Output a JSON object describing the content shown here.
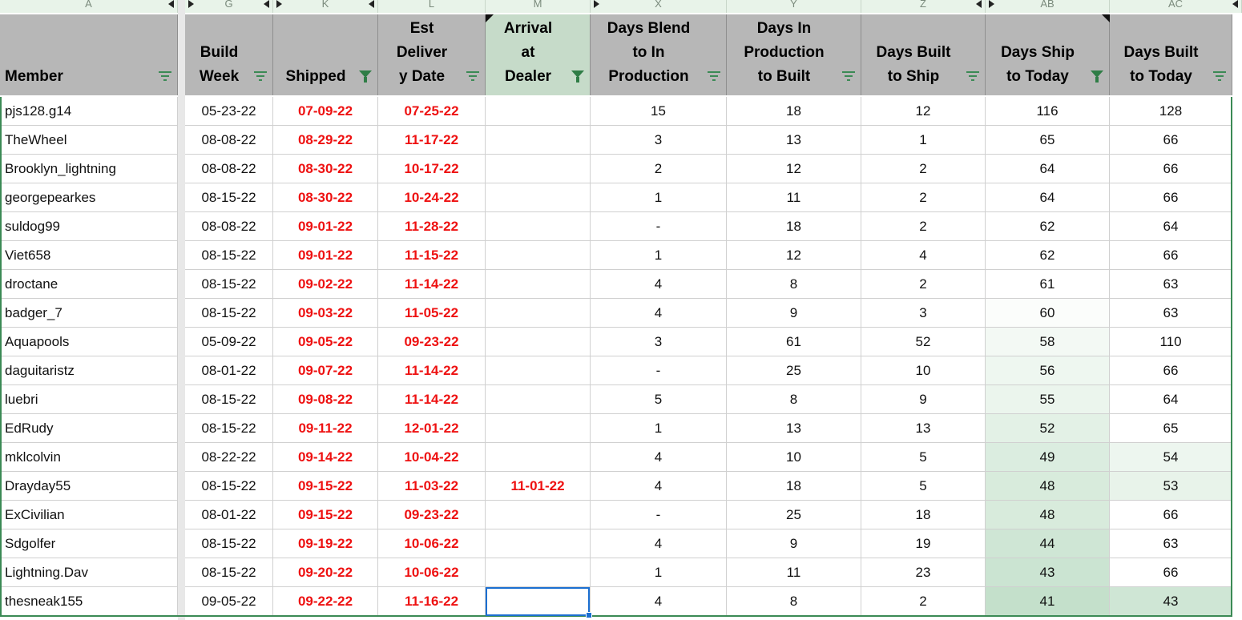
{
  "column_letters": [
    "A",
    "G",
    "K",
    "L",
    "M",
    "X",
    "Y",
    "Z",
    "AB",
    "AC"
  ],
  "headers": [
    {
      "label": "Member",
      "filter": "lines"
    },
    {
      "label": "Build\nWeek",
      "filter": "lines"
    },
    {
      "label": "Shipped",
      "filter": "funnel"
    },
    {
      "label": "Est\nDeliver\ny Date",
      "filter": "lines"
    },
    {
      "label": "Arrival\nat\nDealer",
      "filter": "funnel"
    },
    {
      "label": "Days Blend\nto In\nProduction",
      "filter": "lines"
    },
    {
      "label": "Days In\nProduction\nto Built",
      "filter": "lines"
    },
    {
      "label": "Days Built\nto Ship",
      "filter": "lines"
    },
    {
      "label": "Days Ship\nto Today",
      "filter": "funnel"
    },
    {
      "label": "Days Built\nto Today",
      "filter": "lines"
    }
  ],
  "rows": [
    [
      "pjs128.g14",
      "05-23-22",
      "07-09-22",
      "07-25-22",
      "",
      "15",
      "18",
      "12",
      "116",
      "128"
    ],
    [
      "TheWheel",
      "08-08-22",
      "08-29-22",
      "11-17-22",
      "",
      "3",
      "13",
      "1",
      "65",
      "66"
    ],
    [
      "Brooklyn_lightning",
      "08-08-22",
      "08-30-22",
      "10-17-22",
      "",
      "2",
      "12",
      "2",
      "64",
      "66"
    ],
    [
      "georgepearkes",
      "08-15-22",
      "08-30-22",
      "10-24-22",
      "",
      "1",
      "11",
      "2",
      "64",
      "66"
    ],
    [
      "suldog99",
      "08-08-22",
      "09-01-22",
      "11-28-22",
      "",
      "-",
      "18",
      "2",
      "62",
      "64"
    ],
    [
      "Viet658",
      "08-15-22",
      "09-01-22",
      "11-15-22",
      "",
      "1",
      "12",
      "4",
      "62",
      "66"
    ],
    [
      "droctane",
      "08-15-22",
      "09-02-22",
      "11-14-22",
      "",
      "4",
      "8",
      "2",
      "61",
      "63"
    ],
    [
      "badger_7",
      "08-15-22",
      "09-03-22",
      "11-05-22",
      "",
      "4",
      "9",
      "3",
      "60",
      "63"
    ],
    [
      "Aquapools",
      "05-09-22",
      "09-05-22",
      "09-23-22",
      "",
      "3",
      "61",
      "52",
      "58",
      "110"
    ],
    [
      "daguitaristz",
      "08-01-22",
      "09-07-22",
      "11-14-22",
      "",
      "-",
      "25",
      "10",
      "56",
      "66"
    ],
    [
      "luebri",
      "08-15-22",
      "09-08-22",
      "11-14-22",
      "",
      "5",
      "8",
      "9",
      "55",
      "64"
    ],
    [
      "EdRudy",
      "08-15-22",
      "09-11-22",
      "12-01-22",
      "",
      "1",
      "13",
      "13",
      "52",
      "65"
    ],
    [
      "mklcolvin",
      "08-22-22",
      "09-14-22",
      "10-04-22",
      "",
      "4",
      "10",
      "5",
      "49",
      "54"
    ],
    [
      "Drayday55",
      "08-15-22",
      "09-15-22",
      "11-03-22",
      "11-01-22",
      "4",
      "18",
      "5",
      "48",
      "53"
    ],
    [
      "ExCivilian",
      "08-01-22",
      "09-15-22",
      "09-23-22",
      "",
      "-",
      "25",
      "18",
      "48",
      "66"
    ],
    [
      "Sdgolfer",
      "08-15-22",
      "09-19-22",
      "10-06-22",
      "",
      "4",
      "9",
      "19",
      "44",
      "63"
    ],
    [
      "Lightning.Dav",
      "08-15-22",
      "09-20-22",
      "10-06-22",
      "",
      "1",
      "11",
      "23",
      "43",
      "66"
    ],
    [
      "thesneak155",
      "09-05-22",
      "09-22-22",
      "11-16-22",
      "",
      "4",
      "8",
      "2",
      "41",
      "43"
    ]
  ],
  "heat_colors": {
    "days_ship_to_today": [
      "#ffffff",
      "#ffffff",
      "#ffffff",
      "#ffffff",
      "#ffffff",
      "#ffffff",
      "#ffffff",
      "#fbfdfb",
      "#f3f9f4",
      "#eef7f0",
      "#ebf5ed",
      "#e3f1e6",
      "#dbede0",
      "#d8ebdc",
      "#d8ebdc",
      "#cfe6d5",
      "#cbe4d2",
      "#c4e0cb"
    ],
    "days_built_to_today": [
      "#ffffff",
      "#ffffff",
      "#ffffff",
      "#ffffff",
      "#ffffff",
      "#ffffff",
      "#ffffff",
      "#ffffff",
      "#ffffff",
      "#ffffff",
      "#ffffff",
      "#ffffff",
      "#edf6ef",
      "#e8f3ea",
      "#ffffff",
      "#ffffff",
      "#ffffff",
      "#cfe6d5"
    ]
  }
}
